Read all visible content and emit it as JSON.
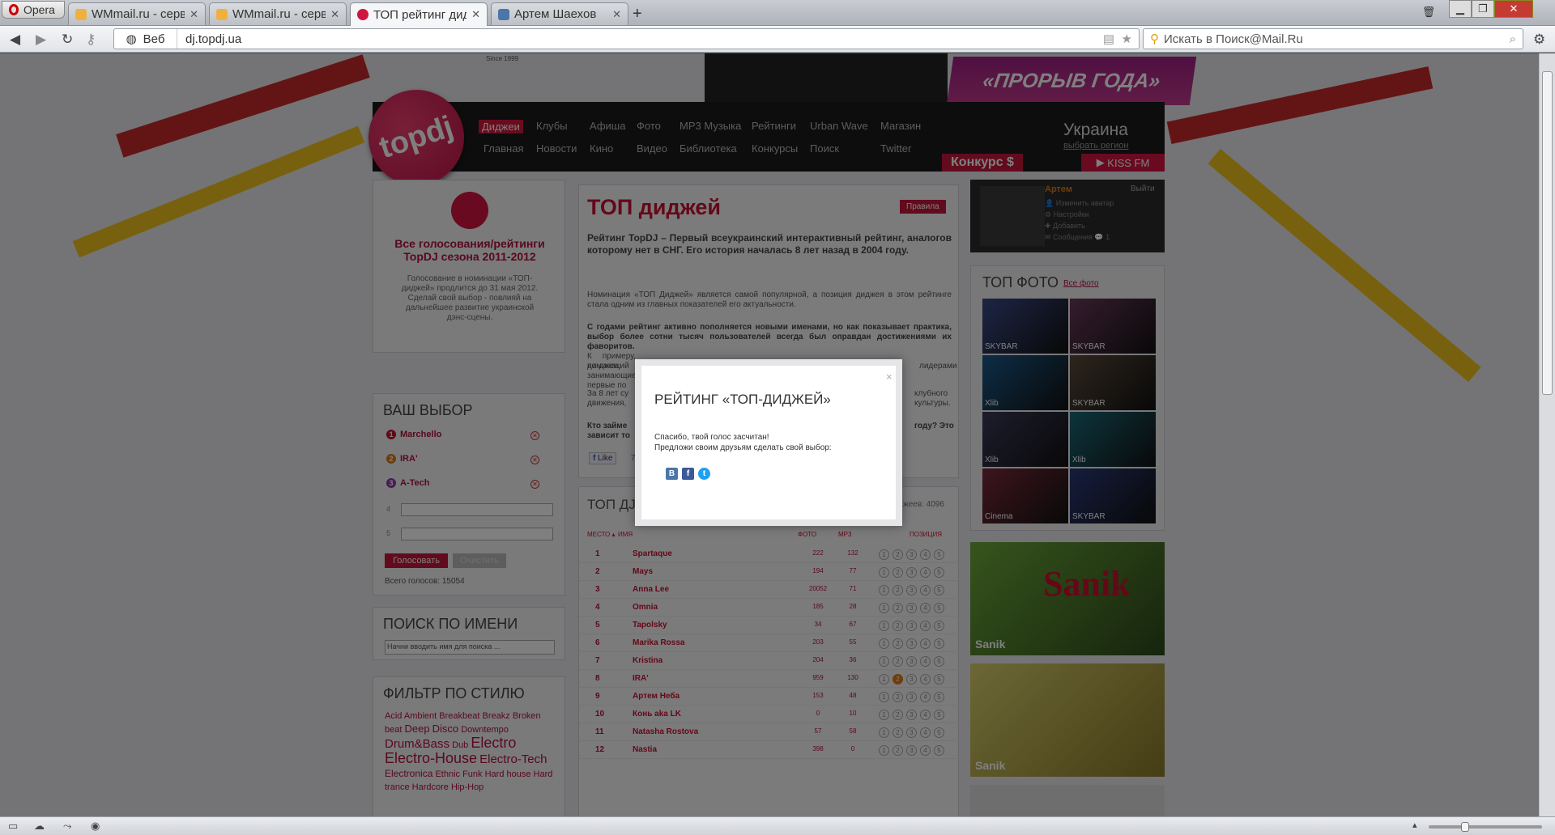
{
  "browser": {
    "opera_label": "Opera",
    "tabs": [
      {
        "label": "WMmail.ru - серв..."
      },
      {
        "label": "WMmail.ru - серв..."
      },
      {
        "label": "ТОП рейтинг дид..."
      },
      {
        "label": "Артем Шаехов"
      }
    ],
    "new_tab": "+",
    "web_label": "Веб",
    "url": "dj.topdj.ua",
    "search_placeholder": "Искать в Поиск@Mail.Ru"
  },
  "header": {
    "logo": "topdj",
    "nav_row1": [
      "Диджеи",
      "Клубы",
      "Афиша",
      "Фото",
      "MP3 Музыка",
      "Рейтинги",
      "Urban Wave",
      "Магазин"
    ],
    "nav_row2": [
      "Главная",
      "Новости",
      "Кино",
      "Видео",
      "Библиотека",
      "Конкурсы",
      "Поиск",
      "Twitter"
    ],
    "region": "Украина",
    "region_link": "выбрать регион",
    "promo": "«ПРОРЫВ ГОДА»",
    "konkurs": "Конкурс $",
    "kiss": "KISS FM",
    "since": "Since 1999"
  },
  "sidebar": {
    "promo_title": "Все голосования/рейтинги TopDJ сезона 2011-2012",
    "promo_text": "Голосование в номинации «ТОП-диджей» продлится до 31 мая 2012. Сделай свой выбор - повлияй на дальнейшее развитие украинской дэнс-сцены.",
    "vote_title": "ВАШ ВЫБОР",
    "votes": [
      {
        "n": "1",
        "name": "Marchello",
        "color": "#c8102e"
      },
      {
        "n": "2",
        "name": "IRA'",
        "color": "#e07b10"
      },
      {
        "n": "3",
        "name": "A-Tech",
        "color": "#8e3aa6"
      }
    ],
    "slot4": "4",
    "slot5": "5",
    "vote_btn": "Голосовать",
    "clear_btn": "Очистить",
    "total": "Всего голосов: 15054",
    "search_title": "ПОИСК ПО ИМЕНИ",
    "search_placeholder": "Начни вводить имя для поиска ...",
    "filter_title": "ФИЛЬТР ПО СТИЛЮ",
    "tags": [
      "Acid",
      "Ambient",
      "Breakbeat",
      "Breakz",
      "Broken beat",
      "Deep",
      "Disco",
      "Downtempo",
      "Drum&Bass",
      "Dub",
      "Electro",
      "Electro-House",
      "Electro-Tech",
      "Electronica",
      "Ethnic",
      "Funk",
      "Hard house",
      "Hard trance",
      "Hardcore",
      "Hip-Hop"
    ]
  },
  "main": {
    "title": "ТОП диджей",
    "rules": "Правила",
    "lead": "Рейтинг TopDJ – Первый всеукраинский интерактивный рейтинг, аналогов которому нет в СНГ. Его история началась 8 лет назад в 2004 году.",
    "p1": "Номинация «ТОП Диджей» является самой популярной, а позиция диджея в этом рейтинге стала одним из главных показателей его актуальности.",
    "p2": "С годами рейтинг активно пополняется новыми именами, но как показывает практика, выбор более сотни тысяч пользователей всегда был оправдан достижениями их фаворитов.",
    "p2b": "К примеру, ди-джеи, занимающие первые по",
    "p2c": "лидерами",
    "p2d": "номинаций",
    "p3a": "За 8 лет су",
    "p3b": "клубного",
    "p3c": "движения,",
    "p3d": "культуры.",
    "p4a": "Кто займе",
    "p4b": "году? Это",
    "p4c": "зависит то",
    "like": "Like",
    "like_n": "7"
  },
  "ranking": {
    "title_part": "ТОП ДЈ",
    "count_tail": "жеев: 4096",
    "h_place": "МЕСТО ▴",
    "h_name": "ИМЯ",
    "h_foto": "ФОТО",
    "h_mp3": "MP3",
    "h_pos": "ПОЗИЦИЯ",
    "rows": [
      {
        "n": "1",
        "name": "Spartaque",
        "foto": "222",
        "mp3": "132"
      },
      {
        "n": "2",
        "name": "Mays",
        "foto": "194",
        "mp3": "77"
      },
      {
        "n": "3",
        "name": "Anna Lee",
        "foto": "20052",
        "mp3": "71"
      },
      {
        "n": "4",
        "name": "Omnia",
        "foto": "185",
        "mp3": "28"
      },
      {
        "n": "5",
        "name": "Tapolsky",
        "foto": "34",
        "mp3": "67"
      },
      {
        "n": "6",
        "name": "Marika Rossa",
        "foto": "203",
        "mp3": "55"
      },
      {
        "n": "7",
        "name": "Kristina",
        "foto": "204",
        "mp3": "36"
      },
      {
        "n": "8",
        "name": "IRA'",
        "foto": "959",
        "mp3": "130",
        "sel": 2
      },
      {
        "n": "9",
        "name": "Артем Неба",
        "foto": "153",
        "mp3": "48"
      },
      {
        "n": "10",
        "name": "Конь aka LK",
        "foto": "0",
        "mp3": "10"
      },
      {
        "n": "11",
        "name": "Natasha Rostova",
        "foto": "57",
        "mp3": "58"
      },
      {
        "n": "12",
        "name": "Nastia",
        "foto": "398",
        "mp3": "0"
      }
    ]
  },
  "user": {
    "name": "Артем",
    "logout": "Выйти",
    "links": [
      "Изменить аватар",
      "Настройки",
      "Добавить",
      "Сообщения"
    ],
    "msg_count": "1"
  },
  "photos": {
    "title": "ТОП ФОТО",
    "all": "Все фото",
    "thumbs": [
      "SKYBAR",
      "SKYBAR",
      "Xlib",
      "SKYBAR",
      "Xlib",
      "Xlib",
      "Cinema",
      "SKYBAR"
    ],
    "side1": "Sanik",
    "side1_logo": "Sanik",
    "side2": "Sanik"
  },
  "modal": {
    "title": "РЕЙТИНГ «ТОП-ДИДЖЕЙ»",
    "line1": "Спасибо, твой голос засчитан!",
    "line2": "Предложи своим друзьям сделать свой выбор:",
    "close": "×",
    "vk": "В",
    "fb": "f",
    "tw": "t"
  }
}
